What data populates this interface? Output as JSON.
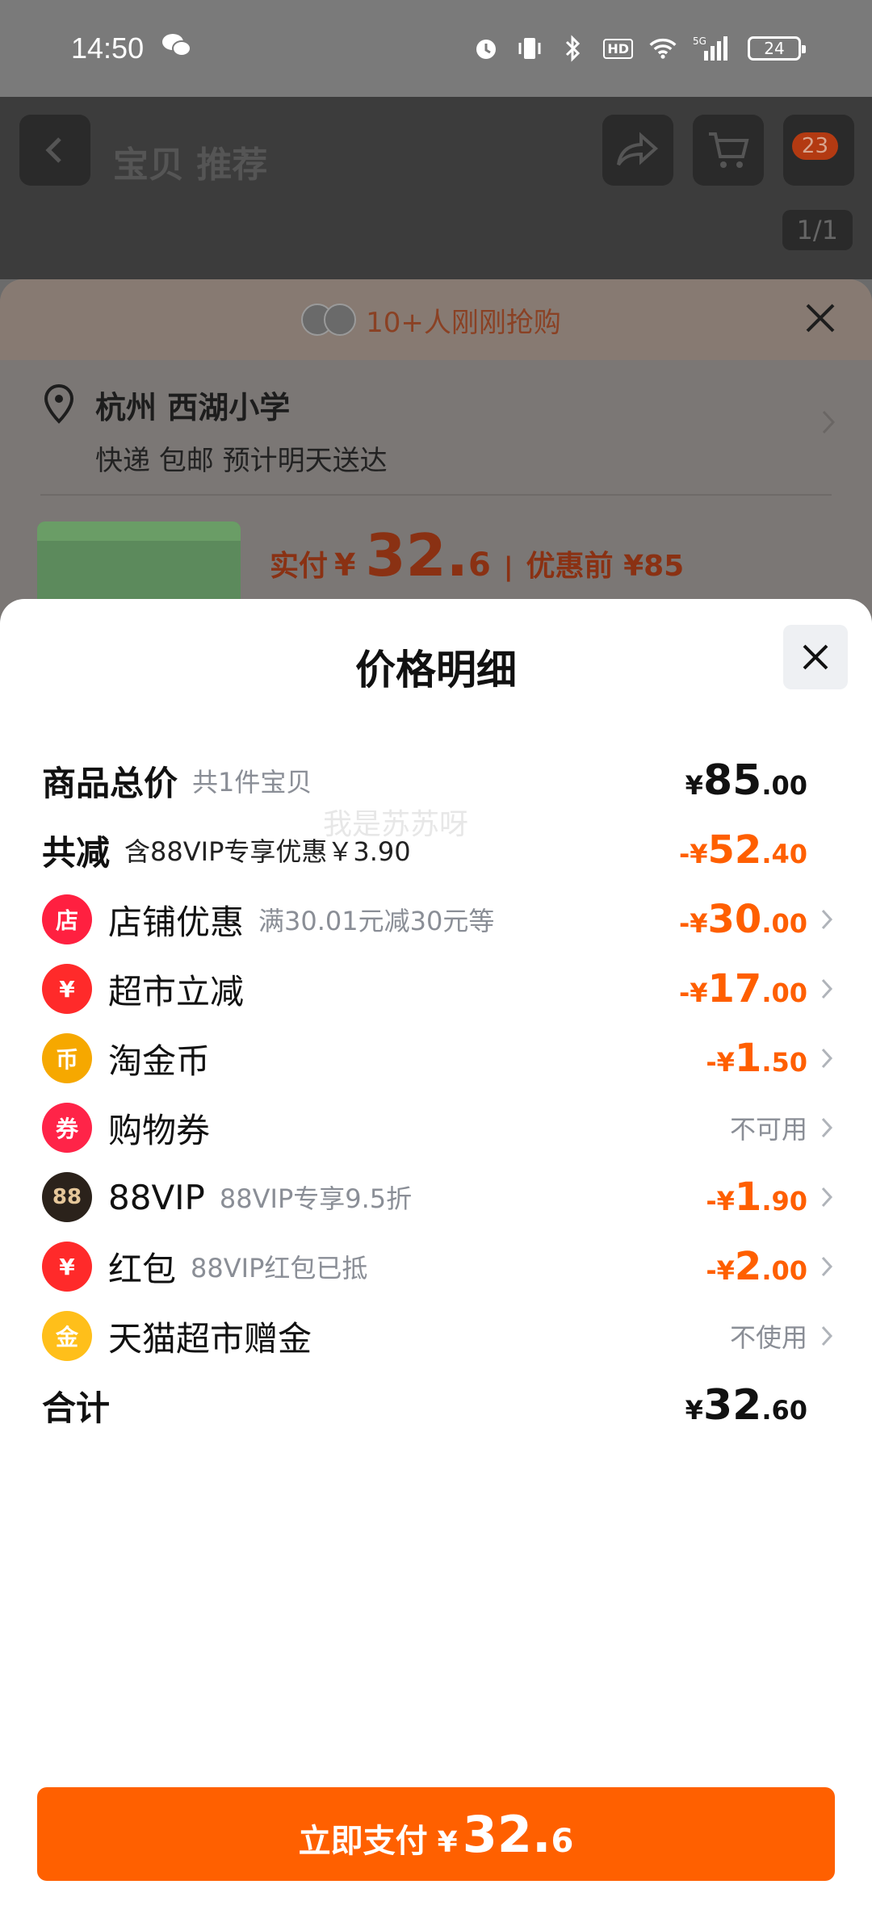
{
  "status_bar": {
    "time": "14:50",
    "network": "5G",
    "hd": "HD",
    "battery": "24"
  },
  "background_page": {
    "title": "宝贝 推荐",
    "cart_badge": "23",
    "image_counter": "1/1",
    "order_banner": "10+人刚刚抢购",
    "address_title": "杭州 西湖小学",
    "address_sub": "快递 包邮 预计明天送达",
    "pay_label": "实付",
    "pay_currency": "¥",
    "pay_int": "32.",
    "pay_dec": "6",
    "pay_sep": "|",
    "pay_original": "优惠前 ¥85"
  },
  "sheet": {
    "title": "价格明细",
    "total_goods": {
      "label": "商品总价",
      "note": "共1件宝贝",
      "cur": "¥",
      "int": "85",
      "dec": ".00"
    },
    "total_discount": {
      "label": "共减",
      "note": "含88VIP专享优惠￥3.90",
      "prefix": "-¥",
      "int": "52",
      "dec": ".40"
    },
    "items": [
      {
        "label": "店铺优惠",
        "note": "满30.01元减30元等",
        "prefix": "-¥",
        "int": "30",
        "dec": ".00",
        "icon": "shop-icon",
        "icon_glyph": "店",
        "color": "#ff2040"
      },
      {
        "label": "超市立减",
        "note": "",
        "prefix": "-¥",
        "int": "17",
        "dec": ".00",
        "icon": "yuan-coupon-icon",
        "icon_glyph": "¥",
        "color": "#ff2a2a"
      },
      {
        "label": "淘金币",
        "note": "",
        "prefix": "-¥",
        "int": "1",
        "dec": ".50",
        "icon": "gold-coin-icon",
        "icon_glyph": "币",
        "color": "#f6a800"
      },
      {
        "label": "购物券",
        "note": "",
        "status": "不可用",
        "icon": "ticket-icon",
        "icon_glyph": "券",
        "color": "#ff2448"
      },
      {
        "label": "88VIP",
        "note": "88VIP专享9.5折",
        "prefix": "-¥",
        "int": "1",
        "dec": ".90",
        "icon": "vip88-icon",
        "icon_glyph": "88",
        "color": "#2b221b"
      },
      {
        "label": "红包",
        "note": "88VIP红包已抵",
        "prefix": "-¥",
        "int": "2",
        "dec": ".00",
        "icon": "red-packet-icon",
        "icon_glyph": "¥",
        "color": "#ff2a2a"
      },
      {
        "label": "天猫超市赠金",
        "note": "",
        "status": "不使用",
        "icon": "gift-money-icon",
        "icon_glyph": "金",
        "color": "#ffbf1a"
      }
    ],
    "sum": {
      "label": "合计",
      "cur": "¥",
      "int": "32",
      "dec": ".60"
    },
    "pay_button": {
      "label": "立即支付",
      "cur": "¥",
      "int": "32.",
      "dec": "6"
    },
    "watermark": "我是苏苏呀"
  },
  "colors": {
    "accent": "#ff6000",
    "discount": "#ff5f00",
    "muted": "#8a8e96"
  }
}
